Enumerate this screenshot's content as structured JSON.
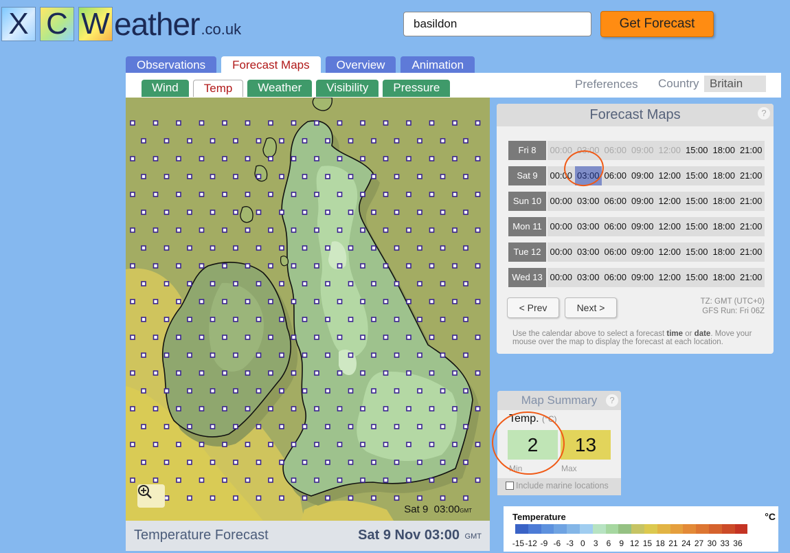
{
  "header": {
    "logo_letters": [
      "X",
      "C",
      "W"
    ],
    "logo_text": "eather",
    "logo_tld": ".co.uk",
    "search_value": "basildon",
    "get_forecast_label": "Get Forecast"
  },
  "tabs": [
    "Observations",
    "Forecast Maps",
    "Overview",
    "Animation"
  ],
  "active_tab": "Forecast Maps",
  "subtabs": [
    "Wind",
    "Temp",
    "Weather",
    "Visibility",
    "Pressure"
  ],
  "active_subtab": "Temp",
  "preferences_label": "Preferences",
  "country_label": "Country",
  "country_value": "Britain",
  "map": {
    "stamp_day": "Sat 9",
    "stamp_time": "03:00",
    "stamp_tz": "GMT",
    "caption_title": "Temperature Forecast",
    "caption_date": "Sat 9 Nov 03:00",
    "caption_tz": "GMT",
    "zoom_icon": "zoom-in-icon"
  },
  "forecast": {
    "title": "Forecast Maps",
    "help": "?",
    "days": [
      {
        "label": "Fri 8",
        "times": [
          "00:00",
          "03:00",
          "06:00",
          "09:00",
          "12:00",
          "15:00",
          "18:00",
          "21:00"
        ],
        "disabled": [
          0,
          1,
          2,
          3,
          4
        ]
      },
      {
        "label": "Sat 9",
        "times": [
          "00:00",
          "03:00",
          "06:00",
          "09:00",
          "12:00",
          "15:00",
          "18:00",
          "21:00"
        ],
        "selected": 1
      },
      {
        "label": "Sun 10",
        "times": [
          "00:00",
          "03:00",
          "06:00",
          "09:00",
          "12:00",
          "15:00",
          "18:00",
          "21:00"
        ]
      },
      {
        "label": "Mon 11",
        "times": [
          "00:00",
          "03:00",
          "06:00",
          "09:00",
          "12:00",
          "15:00",
          "18:00",
          "21:00"
        ]
      },
      {
        "label": "Tue 12",
        "times": [
          "00:00",
          "03:00",
          "06:00",
          "09:00",
          "12:00",
          "15:00",
          "18:00",
          "21:00"
        ]
      },
      {
        "label": "Wed 13",
        "times": [
          "00:00",
          "03:00",
          "06:00",
          "09:00",
          "12:00",
          "15:00",
          "18:00",
          "21:00"
        ]
      }
    ],
    "prev_label": "< Prev",
    "next_label": "Next >",
    "tz_line": "TZ: GMT (UTC+0)",
    "gfs_line": "GFS Run: Fri 06Z",
    "help_1": "Use the calendar above to select a forecast ",
    "help_time": "time",
    "help_or": " or ",
    "help_date": "date",
    "help_2": ". Move your mouse over the map to display the forecast at each location."
  },
  "summary": {
    "title": "Map Summary",
    "help": "?",
    "temp_label": "Temp.",
    "temp_unit": "(°C)",
    "min": "2",
    "max": "13",
    "min_label": "Min",
    "max_label": "Max",
    "marine_label": "Include marine locations"
  },
  "legend": {
    "title": "Temperature",
    "unit": "°C",
    "ticks": [
      "-15",
      "-12",
      "-9",
      "-6",
      "-3",
      "0",
      "3",
      "6",
      "9",
      "12",
      "15",
      "18",
      "21",
      "24",
      "27",
      "30",
      "33",
      "36"
    ],
    "colors": [
      "#3a63c6",
      "#4c7bd6",
      "#5d91de",
      "#6fa3e2",
      "#84b6e7",
      "#a0cdf0",
      "#b7e3c2",
      "#a6d7a0",
      "#95c183",
      "#c6c464",
      "#dcc94f",
      "#e2b444",
      "#e59f3d",
      "#e38a37",
      "#dd7632",
      "#d5622d",
      "#cc4b28",
      "#c43424"
    ]
  }
}
